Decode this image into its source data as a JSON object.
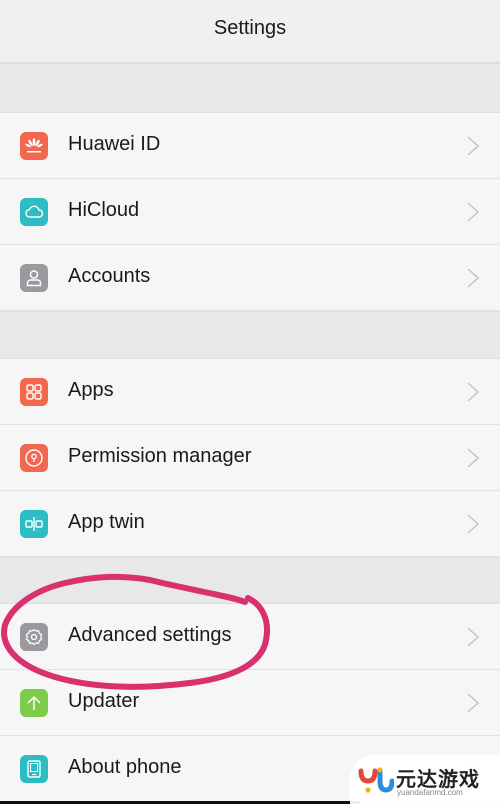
{
  "header": {
    "title": "Settings"
  },
  "groups": [
    {
      "items": [
        {
          "label": "Huawei ID",
          "icon": "huawei-logo-icon",
          "color": "#f2684e"
        },
        {
          "label": "HiCloud",
          "icon": "cloud-icon",
          "color": "#2bbcc4"
        },
        {
          "label": "Accounts",
          "icon": "person-icon",
          "color": "#9a9a9e"
        }
      ]
    },
    {
      "items": [
        {
          "label": "Apps",
          "icon": "grid-icon",
          "color": "#f2684e"
        },
        {
          "label": "Permission manager",
          "icon": "keyhole-icon",
          "color": "#f2684e"
        },
        {
          "label": "App twin",
          "icon": "app-twin-icon",
          "color": "#2bbcc4"
        }
      ]
    },
    {
      "items": [
        {
          "label": "Advanced settings",
          "icon": "gear-icon",
          "color": "#9a9a9e"
        },
        {
          "label": "Updater",
          "icon": "arrow-up-icon",
          "color": "#7ccb4a"
        },
        {
          "label": "About phone",
          "icon": "phone-icon",
          "color": "#2bbcc4"
        }
      ]
    }
  ],
  "annotation": {
    "color": "#d9306f",
    "target": "Advanced settings"
  },
  "watermark": {
    "name": "元达游戏",
    "url": "yuandafanmd.com"
  }
}
